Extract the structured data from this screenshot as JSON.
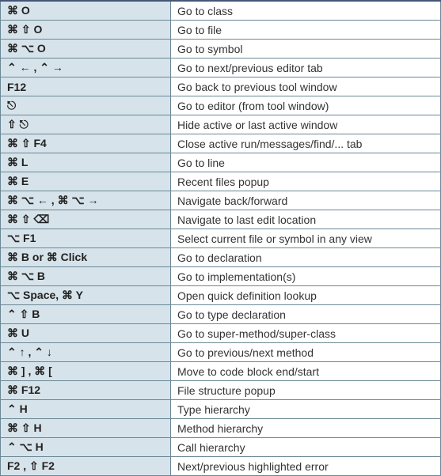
{
  "rows": [
    {
      "shortcut": "⌘ O",
      "desc": "Go to class"
    },
    {
      "shortcut": "⌘ ⇧ O",
      "desc": "Go to file"
    },
    {
      "shortcut": "⌘ ⌥ O",
      "desc": "Go to symbol"
    },
    {
      "shortcut": "⌃ ← , ⌃ →",
      "desc": "Go to next/previous editor tab"
    },
    {
      "shortcut": "F12",
      "desc": "Go back to previous tool window"
    },
    {
      "shortcut": "⎋",
      "desc": "Go to editor (from tool window)"
    },
    {
      "shortcut": "⇧ ⎋",
      "desc": "Hide active or last active window"
    },
    {
      "shortcut": "⌘ ⇧ F4",
      "desc": "Close active run/messages/find/... tab"
    },
    {
      "shortcut": "⌘ L",
      "desc": "Go to line"
    },
    {
      "shortcut": "⌘ E",
      "desc": "Recent files popup"
    },
    {
      "shortcut": "⌘ ⌥ ← , ⌘ ⌥ →",
      "desc": "Navigate back/forward"
    },
    {
      "shortcut": "⌘ ⇧ ⌫",
      "desc": "Navigate to last edit location"
    },
    {
      "shortcut": "⌥ F1",
      "desc": "Select current file or symbol in any view"
    },
    {
      "shortcut": "⌘ B or ⌘ Click",
      "desc": "Go to declaration"
    },
    {
      "shortcut": "⌘ ⌥ B",
      "desc": "Go to implementation(s)"
    },
    {
      "shortcut": "⌥ Space, ⌘ Y",
      "desc": "Open quick definition lookup"
    },
    {
      "shortcut": "⌃ ⇧ B",
      "desc": "Go to type declaration"
    },
    {
      "shortcut": "⌘ U",
      "desc": "Go to super-method/super-class"
    },
    {
      "shortcut": "⌃ ↑ , ⌃ ↓",
      "desc": "Go to previous/next method"
    },
    {
      "shortcut": "⌘ ] , ⌘ [",
      "desc": "Move to code block end/start"
    },
    {
      "shortcut": "⌘ F12",
      "desc": "File structure popup"
    },
    {
      "shortcut": "⌃ H",
      "desc": "Type hierarchy"
    },
    {
      "shortcut": "⌘ ⇧ H",
      "desc": "Method hierarchy"
    },
    {
      "shortcut": "⌃ ⌥ H",
      "desc": "Call hierarchy"
    },
    {
      "shortcut": "F2 , ⇧ F2",
      "desc": "Next/previous highlighted error"
    }
  ]
}
